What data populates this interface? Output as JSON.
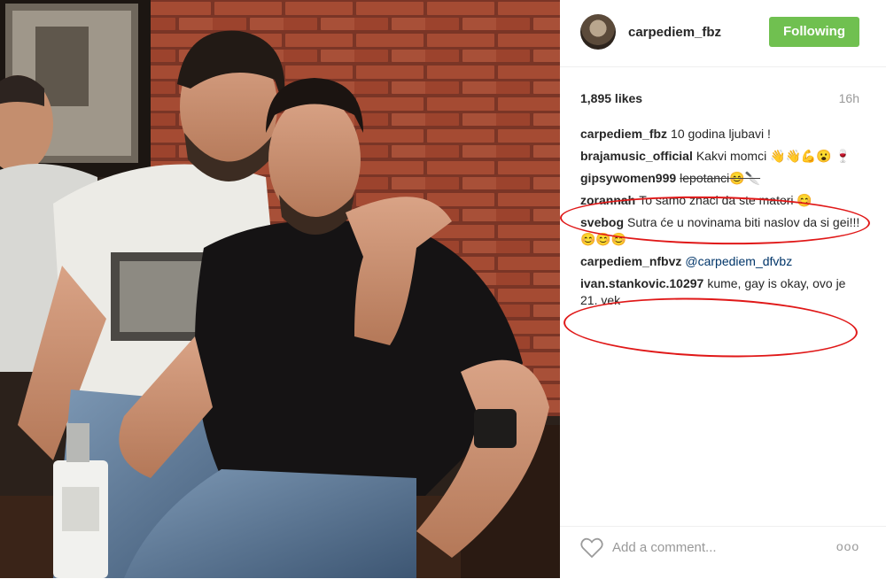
{
  "post": {
    "username": "carpediem_fbz",
    "follow_label": "Following",
    "likes": "1,895 likes",
    "time": "16h",
    "comments": [
      {
        "user": "carpediem_fbz",
        "text": "10 godina ljubavi !"
      },
      {
        "user": "brajamusic_official",
        "text": "Kakvi momci 👋👋💪😮 🍷"
      },
      {
        "user": "gipsywomen999",
        "text": "lepotanci😊🔪",
        "struck": true
      },
      {
        "user": "zorannah",
        "text": "To samo znaci da ste matori 😊"
      },
      {
        "user": "svebog",
        "text": "Sutra će u novinama biti naslov da si gei!!!😊😊😊"
      },
      {
        "user": "carpediem_nfbvz",
        "text": "@carpediem_dfvbz"
      },
      {
        "user": "ivan.stankovic.10297",
        "text": "kume, gay is okay, ovo je 21. vek"
      }
    ],
    "add_comment_placeholder": "Add a comment...",
    "more_label": "ooo"
  },
  "colors": {
    "follow_bg": "#70c050",
    "circle": "#e01818",
    "brick": "#a44a32"
  },
  "icons": {
    "like": "heart-icon",
    "options": "more-options-icon"
  }
}
